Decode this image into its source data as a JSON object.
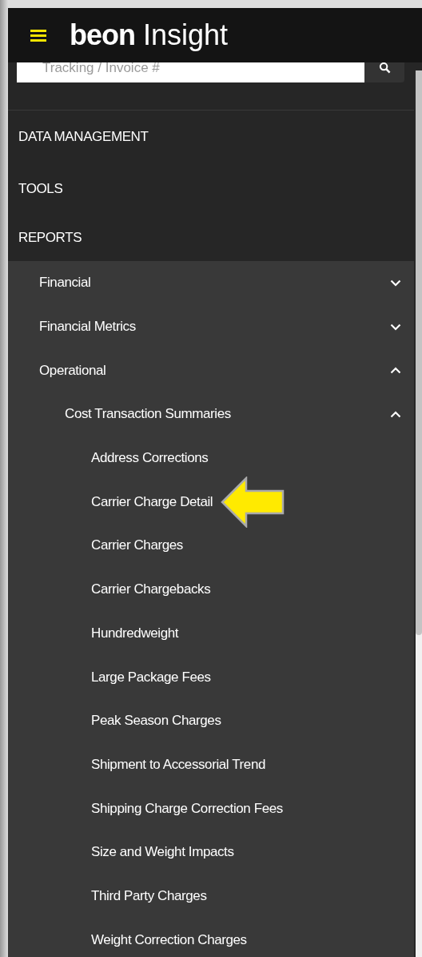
{
  "header": {
    "brand": "beon",
    "product": "Insight"
  },
  "search": {
    "placeholder": "Tracking / Invoice #"
  },
  "nav": [
    {
      "label": "DATA MANAGEMENT",
      "expanded": false
    },
    {
      "label": "TOOLS",
      "expanded": false
    },
    {
      "label": "REPORTS",
      "expanded": true,
      "children": [
        {
          "label": "Financial",
          "expanded": false
        },
        {
          "label": "Financial Metrics",
          "expanded": false
        },
        {
          "label": "Operational",
          "expanded": true,
          "children": [
            {
              "label": "Cost Transaction Summaries",
              "expanded": true,
              "children": [
                {
                  "label": "Address Corrections",
                  "pointer": false
                },
                {
                  "label": "Carrier Charge Detail",
                  "pointer": true
                },
                {
                  "label": "Carrier Charges",
                  "pointer": false
                },
                {
                  "label": "Carrier Chargebacks",
                  "pointer": false
                },
                {
                  "label": "Hundredweight",
                  "pointer": false
                },
                {
                  "label": "Large Package Fees",
                  "pointer": false
                },
                {
                  "label": "Peak Season Charges",
                  "pointer": false
                },
                {
                  "label": "Shipment to Accessorial Trend",
                  "pointer": false
                },
                {
                  "label": "Shipping Charge Correction Fees",
                  "pointer": false
                },
                {
                  "label": "Size and Weight Impacts",
                  "pointer": false
                },
                {
                  "label": "Third Party Charges",
                  "pointer": false
                },
                {
                  "label": "Weight Correction Charges",
                  "pointer": false
                }
              ]
            }
          ]
        }
      ]
    }
  ]
}
